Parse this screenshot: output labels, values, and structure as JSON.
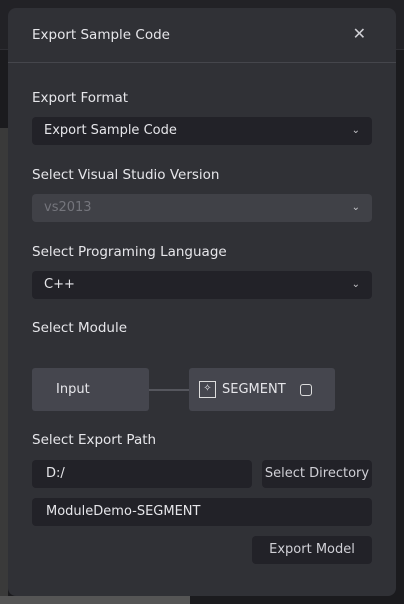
{
  "dialog": {
    "title": "Export Sample Code",
    "close_icon": "close-icon"
  },
  "export_format": {
    "label": "Export Format",
    "value": "Export Sample Code"
  },
  "vs_version": {
    "label": "Select Visual Studio Version",
    "value": "vs2013",
    "disabled": true
  },
  "language": {
    "label": "Select Programing Language",
    "value": "C++"
  },
  "module": {
    "label": "Select Module",
    "input_node": "Input",
    "segment_node": "SEGMENT",
    "segment_checked": false
  },
  "export_path": {
    "label": "Select Export Path",
    "path": "D:/",
    "select_directory": "Select Directory",
    "name": "ModuleDemo-SEGMENT",
    "export_button": "Export Model"
  }
}
